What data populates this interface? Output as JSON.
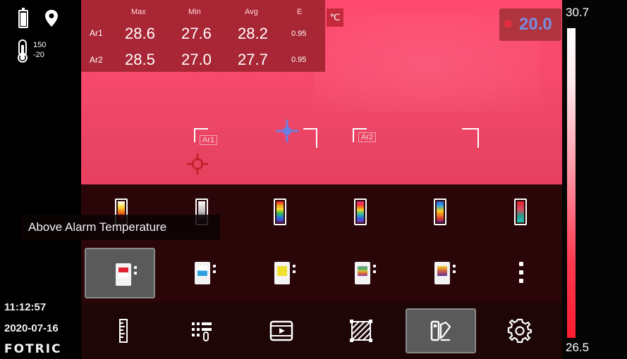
{
  "status": {
    "battery_icon": "battery-icon",
    "location_icon": "location-pin-icon",
    "thermometer_icon": "thermometer-range-icon",
    "range_high": "150",
    "range_low": "-20",
    "time": "11:12:57",
    "date": "2020-07-16",
    "brand": "FOTRIC"
  },
  "measurements": {
    "headers": {
      "max": "Max",
      "min": "Min",
      "avg": "Avg",
      "e": "E"
    },
    "rows": [
      {
        "label": "Ar1",
        "max": "28.6",
        "min": "27.6",
        "avg": "28.2",
        "e": "0.95"
      },
      {
        "label": "Ar2",
        "max": "28.5",
        "min": "27.0",
        "avg": "27.7",
        "e": "0.95"
      }
    ],
    "unit": "℃"
  },
  "alarm": {
    "value": "20.0",
    "color": "#7b8ee0"
  },
  "scale": {
    "max": "30.7",
    "min": "26.5"
  },
  "regions": [
    {
      "label": "Ar1"
    },
    {
      "label": "Ar2"
    }
  ],
  "palette": {
    "tooltip": "Above Alarm Temperature",
    "icon_names": [
      "iron-palette-icon",
      "grey-palette-icon",
      "rainbow-palette-icon",
      "rainbow-hc-palette-icon",
      "lava-palette-icon",
      "medical-palette-icon"
    ]
  },
  "alarm_modes": {
    "icon_names": [
      "above-alarm-icon",
      "below-alarm-icon",
      "between-alarm-icon",
      "isotherm-alarm-icon",
      "gradient-alarm-icon"
    ],
    "selected": "above-alarm-icon",
    "more_icon": "more-vertical-icon"
  },
  "toolbar": {
    "items": [
      "ruler-icon",
      "measure-tools-icon",
      "video-icon",
      "hatch-area-icon",
      "palette-settings-icon",
      "gear-icon"
    ],
    "selected": "palette-settings-icon"
  }
}
